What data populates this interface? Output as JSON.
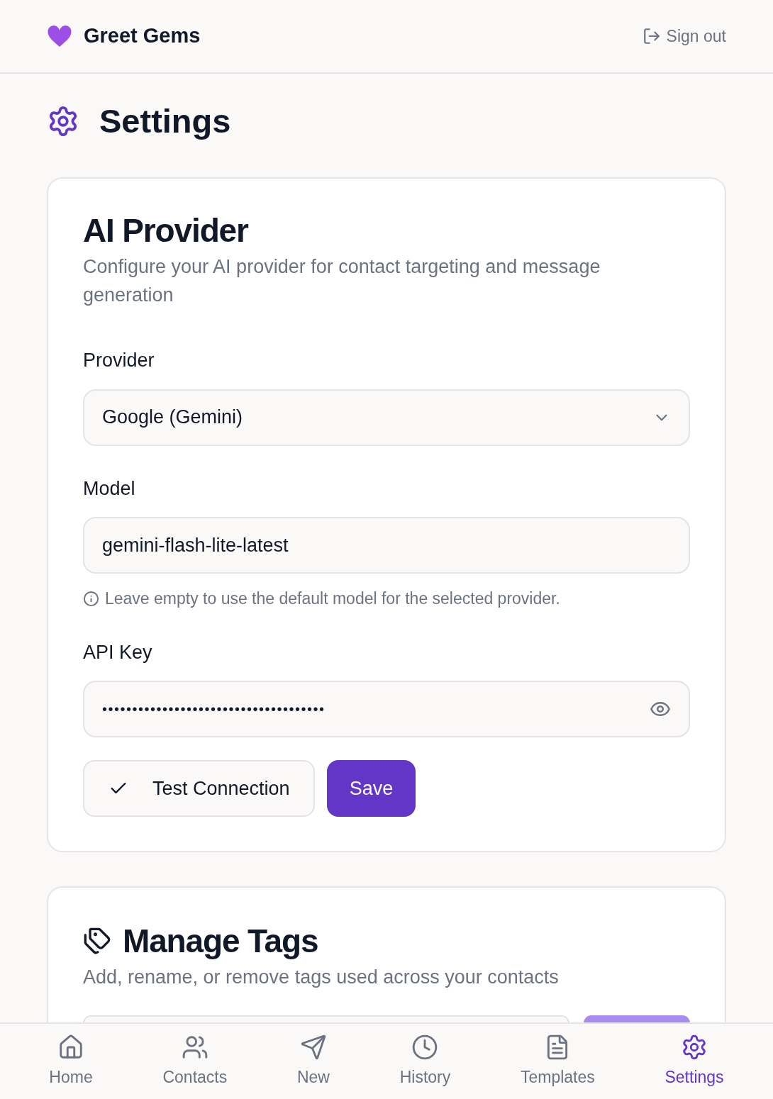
{
  "header": {
    "app_name": "Greet Gems",
    "sign_out": "Sign out"
  },
  "page_title": "Settings",
  "ai_provider": {
    "title": "AI Provider",
    "description": "Configure your AI provider for contact targeting and message generation",
    "provider_label": "Provider",
    "provider_value": "Google (Gemini)",
    "model_label": "Model",
    "model_value": "gemini-flash-lite-latest",
    "model_hint": "Leave empty to use the default model for the selected provider.",
    "api_key_label": "API Key",
    "api_key_value": "•••••••••••••••••••••••••••••••••••••",
    "buttons": [
      {
        "kind": "outline",
        "label": "Test Connection"
      },
      {
        "kind": "primary",
        "label": "Save"
      }
    ]
  },
  "manage_tags": {
    "title": "Manage Tags",
    "description": "Add, rename, or remove tags used across your contacts"
  },
  "bottom_nav": [
    {
      "kind": "home",
      "label": "Home",
      "selected": false
    },
    {
      "kind": "contacts",
      "label": "Contacts",
      "selected": false
    },
    {
      "kind": "new",
      "label": "New",
      "selected": false
    },
    {
      "kind": "history",
      "label": "History",
      "selected": false
    },
    {
      "kind": "templates",
      "label": "Templates",
      "selected": false
    },
    {
      "kind": "settings",
      "label": "Settings",
      "selected": true
    }
  ]
}
